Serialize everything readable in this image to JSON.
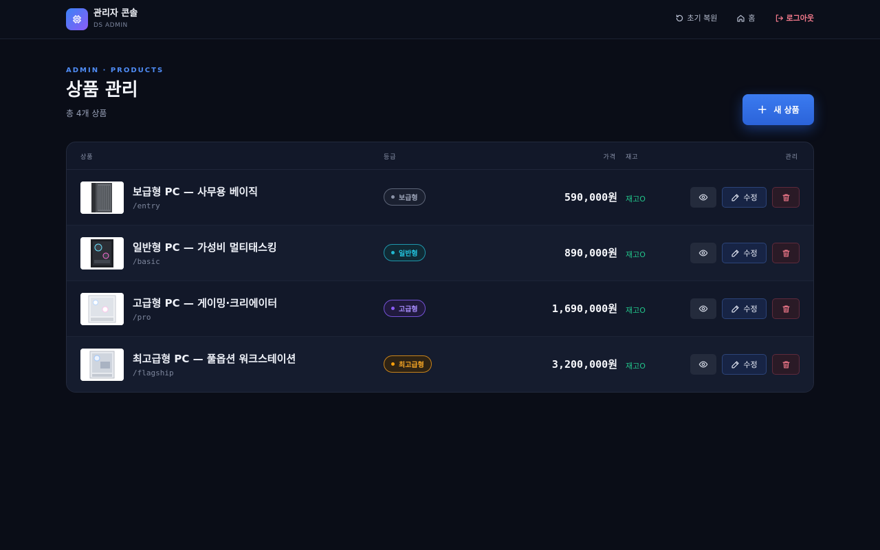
{
  "brand": {
    "title": "관리자 콘솔",
    "subtitle": "DS ADMIN",
    "icon": "cpu-chip-icon"
  },
  "nav": {
    "reset_label": "초기 복원",
    "home_label": "홈",
    "logout_label": "로그아웃"
  },
  "page": {
    "eyebrow": "ADMIN · PRODUCTS",
    "title": "상품 관리",
    "count_text": "총 4개 상품",
    "new_button_label": "새 상품"
  },
  "table": {
    "columns": {
      "product": "상품",
      "grade": "등급",
      "price": "가격",
      "stock": "재고",
      "manage": "관리"
    },
    "rows": [
      {
        "name": "보급형 PC — 사무용 베이직",
        "slug": "/entry",
        "grade": "보급형",
        "price": "590,000원",
        "stock": "재고O",
        "edit_label": "수정",
        "grade_color": "#8b93a8"
      },
      {
        "name": "일반형 PC — 가성비 멀티태스킹",
        "slug": "/basic",
        "grade": "일반형",
        "price": "890,000원",
        "stock": "재고O",
        "edit_label": "수정",
        "grade_color": "#22b8cf"
      },
      {
        "name": "고급형 PC — 게이밍·크리에이터",
        "slug": "/pro",
        "grade": "고급형",
        "price": "1,690,000원",
        "stock": "재고O",
        "edit_label": "수정",
        "grade_color": "#8b5cf6"
      },
      {
        "name": "최고급형 PC — 풀옵션 워크스테이션",
        "slug": "/flagship",
        "grade": "최고급형",
        "price": "3,200,000원",
        "stock": "재고O",
        "edit_label": "수정",
        "grade_color": "#f59e0b"
      }
    ]
  },
  "colors": {
    "accent": "#3b7bf0",
    "stock_ok": "#22c58b",
    "danger": "#f47a8c",
    "background": "#0a0d17"
  }
}
